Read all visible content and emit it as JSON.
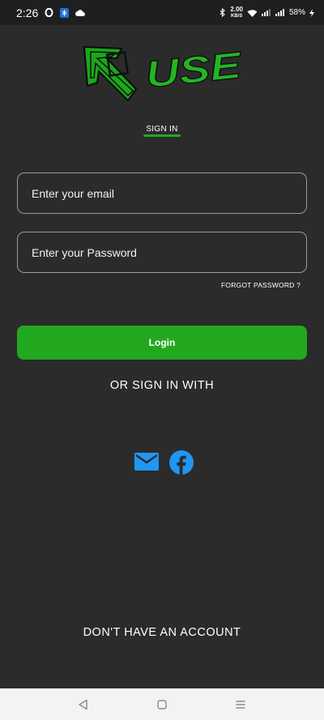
{
  "status_bar": {
    "time": "2:26",
    "net_speed_value": "2.00",
    "net_speed_unit": "KB/S",
    "battery": "58%",
    "icons": [
      "opera-icon",
      "app-notification-icon",
      "cloud-icon",
      "bluetooth-icon",
      "wifi-icon",
      "signal-icon",
      "battery-charging-icon"
    ]
  },
  "logo": {
    "text": "USE",
    "icon": "arrow-logo-icon",
    "color": "#23b523"
  },
  "tabs": {
    "sign_in": "SIGN IN"
  },
  "form": {
    "email_placeholder": "Enter your email",
    "email_value": "",
    "password_placeholder": "Enter your Password",
    "password_value": "",
    "forgot_password": "FORGOT PASSWORD ?",
    "login_label": "Login"
  },
  "alt_signin": {
    "heading": "OR SIGN IN WITH",
    "providers": [
      "mail-icon",
      "facebook-icon"
    ]
  },
  "footer": {
    "no_account": "DON'T HAVE AN ACCOUNT"
  },
  "nav_bar": {
    "buttons": [
      "back-icon",
      "home-icon",
      "recents-icon"
    ]
  },
  "colors": {
    "background": "#2b2b2b",
    "status_bar": "#1f1f1f",
    "accent_green": "#22a81f",
    "social_blue": "#2196f3",
    "nav_bar": "#f3f3f3"
  }
}
